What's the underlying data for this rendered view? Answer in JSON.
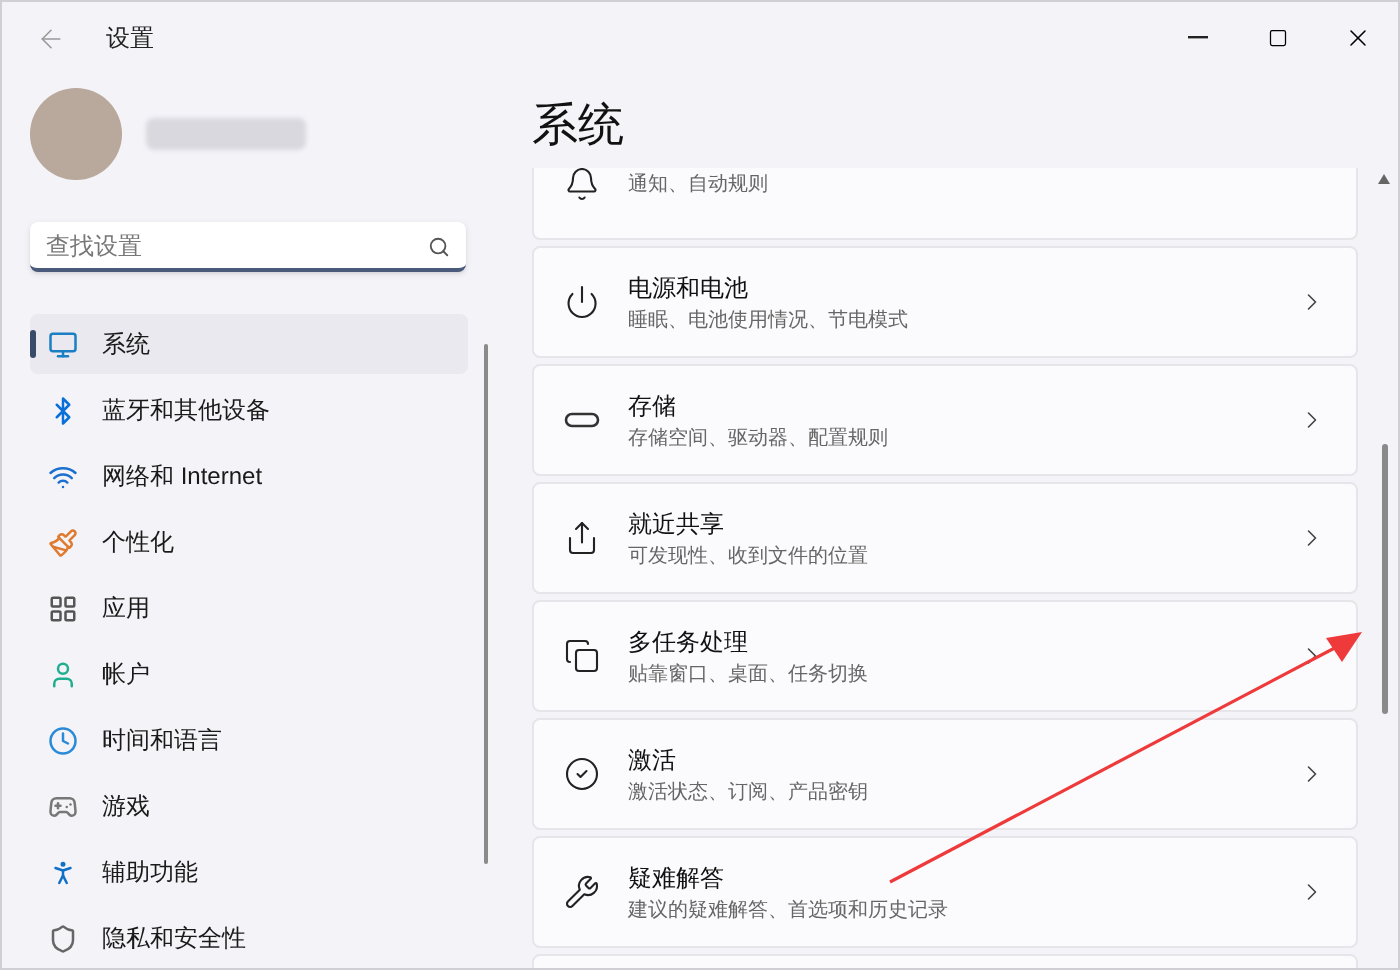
{
  "window": {
    "title": "设置"
  },
  "search": {
    "placeholder": "查找设置"
  },
  "sidebar": {
    "items": [
      {
        "label": "系统",
        "selected": true
      },
      {
        "label": "蓝牙和其他设备",
        "selected": false
      },
      {
        "label": "网络和 Internet",
        "selected": false
      },
      {
        "label": "个性化",
        "selected": false
      },
      {
        "label": "应用",
        "selected": false
      },
      {
        "label": "帐户",
        "selected": false
      },
      {
        "label": "时间和语言",
        "selected": false
      },
      {
        "label": "游戏",
        "selected": false
      },
      {
        "label": "辅助功能",
        "selected": false
      },
      {
        "label": "隐私和安全性",
        "selected": false
      }
    ]
  },
  "page": {
    "title": "系统",
    "cards": [
      {
        "subtitle": "通知、自动规则"
      },
      {
        "title": "电源和电池",
        "subtitle": "睡眠、电池使用情况、节电模式"
      },
      {
        "title": "存储",
        "subtitle": "存储空间、驱动器、配置规则"
      },
      {
        "title": "就近共享",
        "subtitle": "可发现性、收到文件的位置"
      },
      {
        "title": "多任务处理",
        "subtitle": "贴靠窗口、桌面、任务切换"
      },
      {
        "title": "激活",
        "subtitle": "激活状态、订阅、产品密钥"
      },
      {
        "title": "疑难解答",
        "subtitle": "建议的疑难解答、首选项和历史记录"
      }
    ]
  }
}
